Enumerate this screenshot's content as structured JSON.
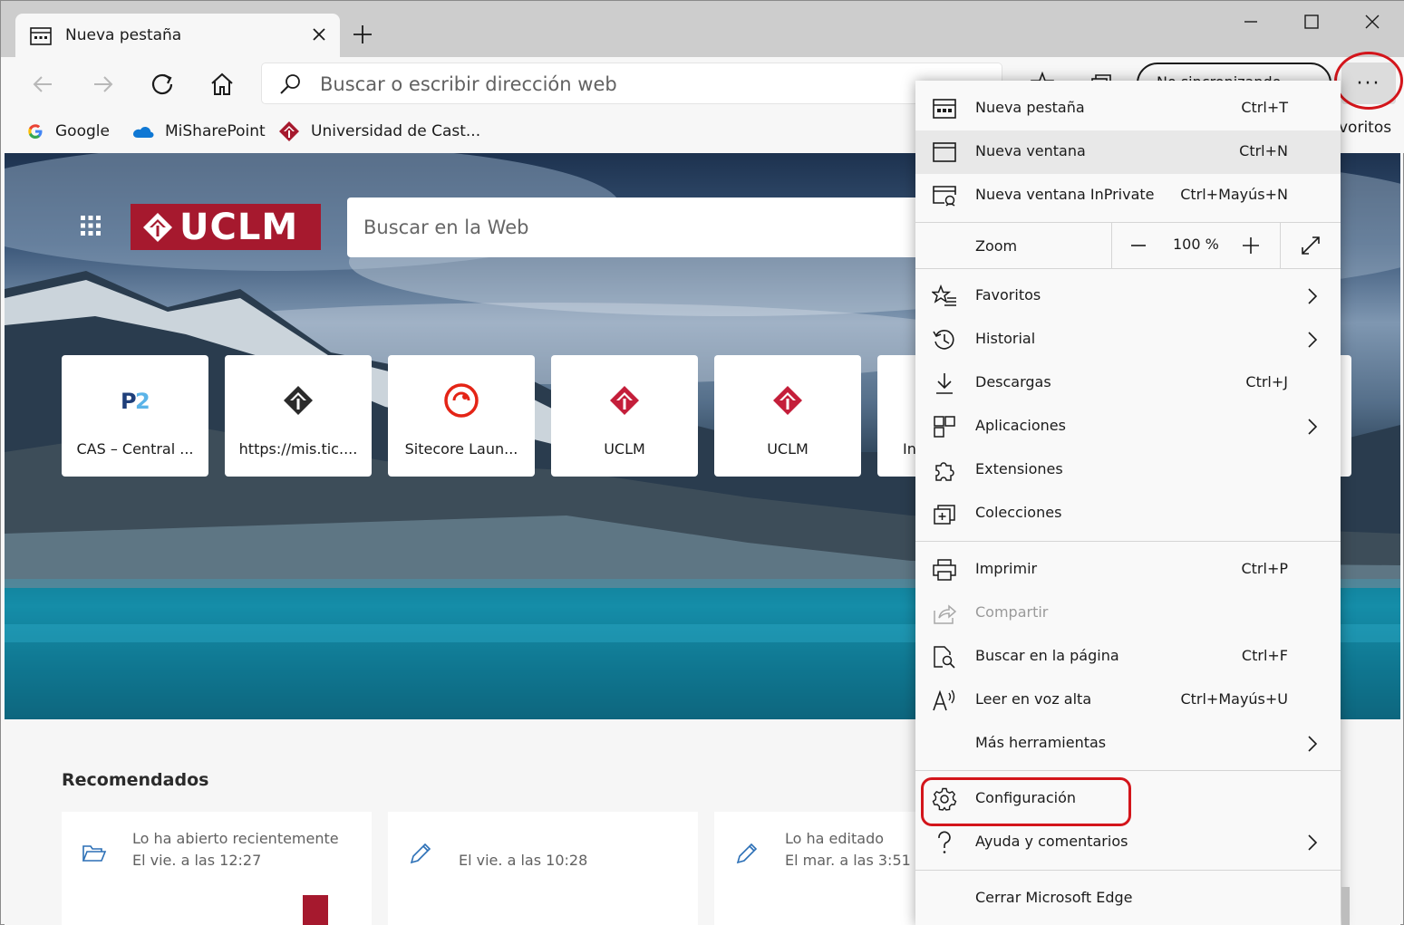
{
  "tab": {
    "title": "Nueva pestaña"
  },
  "toolbar": {
    "address_placeholder": "Buscar o escribir dirección web",
    "profile_label": "No sincronizando",
    "more_label": "···"
  },
  "favorites": {
    "items": [
      {
        "label": "Google",
        "icon": "google-icon"
      },
      {
        "label": "MiSharePoint",
        "icon": "onedrive-cloud-icon"
      },
      {
        "label": "Universidad de Cast...",
        "icon": "uclm-icon"
      }
    ],
    "other_label": "voritos"
  },
  "hero": {
    "logo_text": "UCLM",
    "search_placeholder": "Buscar en la Web",
    "tiles": [
      {
        "label": "CAS – Central ...",
        "icon": "p2-icon"
      },
      {
        "label": "https://mis.tic....",
        "icon": "mis-icon"
      },
      {
        "label": "Sitecore Laun...",
        "icon": "sitecore-icon"
      },
      {
        "label": "UCLM",
        "icon": "uclm-icon"
      },
      {
        "label": "UCLM",
        "icon": "uclm-icon"
      },
      {
        "label": "In",
        "icon": ""
      }
    ]
  },
  "recommended": {
    "title": "Recomendados",
    "cards": [
      {
        "line1": "Lo ha abierto recientemente",
        "line2": "El vie. a las 12:27",
        "icon": "folder-open-icon"
      },
      {
        "line1": "",
        "line2": "El vie. a las 10:28",
        "icon": "pencil-icon"
      },
      {
        "line1": "Lo ha editado",
        "line2": "El mar. a las 3:51",
        "icon": "pencil-icon"
      }
    ]
  },
  "menu": {
    "group1": [
      {
        "label": "Nueva pestaña",
        "shortcut": "Ctrl+T"
      },
      {
        "label": "Nueva ventana",
        "shortcut": "Ctrl+N"
      },
      {
        "label": "Nueva ventana InPrivate",
        "shortcut": "Ctrl+Mayús+N"
      }
    ],
    "zoom": {
      "label": "Zoom",
      "value": "100 %",
      "minus": "—",
      "plus": "+"
    },
    "group2": [
      {
        "label": "Favoritos",
        "shortcut": ""
      },
      {
        "label": "Historial",
        "shortcut": ""
      },
      {
        "label": "Descargas",
        "shortcut": "Ctrl+J"
      },
      {
        "label": "Aplicaciones",
        "shortcut": ""
      },
      {
        "label": "Extensiones",
        "shortcut": ""
      },
      {
        "label": "Colecciones",
        "shortcut": ""
      }
    ],
    "group3": [
      {
        "label": "Imprimir",
        "shortcut": "Ctrl+P"
      },
      {
        "label": "Compartir",
        "shortcut": ""
      },
      {
        "label": "Buscar en la página",
        "shortcut": "Ctrl+F"
      },
      {
        "label": "Leer en voz alta",
        "shortcut": "Ctrl+Mayús+U"
      },
      {
        "label": "Más herramientas",
        "shortcut": ""
      }
    ],
    "group4": [
      {
        "label": "Configuración",
        "shortcut": ""
      },
      {
        "label": "Ayuda y comentarios",
        "shortcut": ""
      }
    ],
    "group5": [
      {
        "label": "Cerrar Microsoft Edge",
        "shortcut": ""
      }
    ]
  },
  "colors": {
    "accent_red": "#d3151b",
    "uclm_red": "#a6192e",
    "menu_bg": "#f9f9f9"
  }
}
